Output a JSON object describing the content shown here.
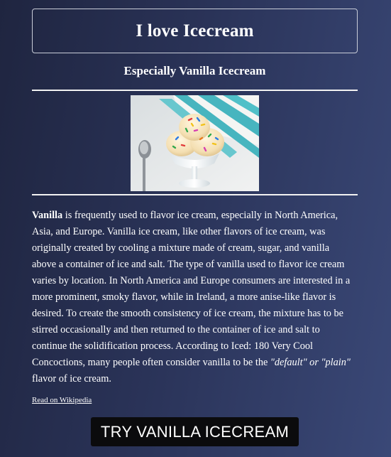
{
  "header": {
    "title": "I love Icecream",
    "subtitle": "Especially Vanilla Icecream"
  },
  "image": {
    "icon": "vanilla-icecream-sundae-photo"
  },
  "article": {
    "lead_bold": "Vanilla",
    "text_1": " is frequently used to flavor ice cream, especially in North America, Asia, and Europe. Vanilla ice cream, like other flavors of ice cream, was originally created by cooling a mixture made of cream, sugar, and vanilla above a container of ice and salt. The type of vanilla used to flavor ice cream varies by location. In North America and Europe consumers are interested in a more prominent, smoky flavor, while in Ireland, a more anise-like flavor is desired. To create the smooth consistency of ice cream, the mixture has to be stirred occasionally and then returned to the container of ice and salt to continue the solidification process. According to Iced: 180 Very Cool Concoctions, many people often consider vanilla to be the ",
    "italic_quote": "\"default\" or \"plain\"",
    "text_2": " flavor of ice cream."
  },
  "link": {
    "label": "Read on Wikipedia"
  },
  "cta": {
    "label": "TRY VANILLA ICECREAM"
  },
  "colors": {
    "background_dark": "#1f2540",
    "background_light": "#3a4877",
    "button": "#0b0b0d",
    "text": "#ffffff"
  }
}
